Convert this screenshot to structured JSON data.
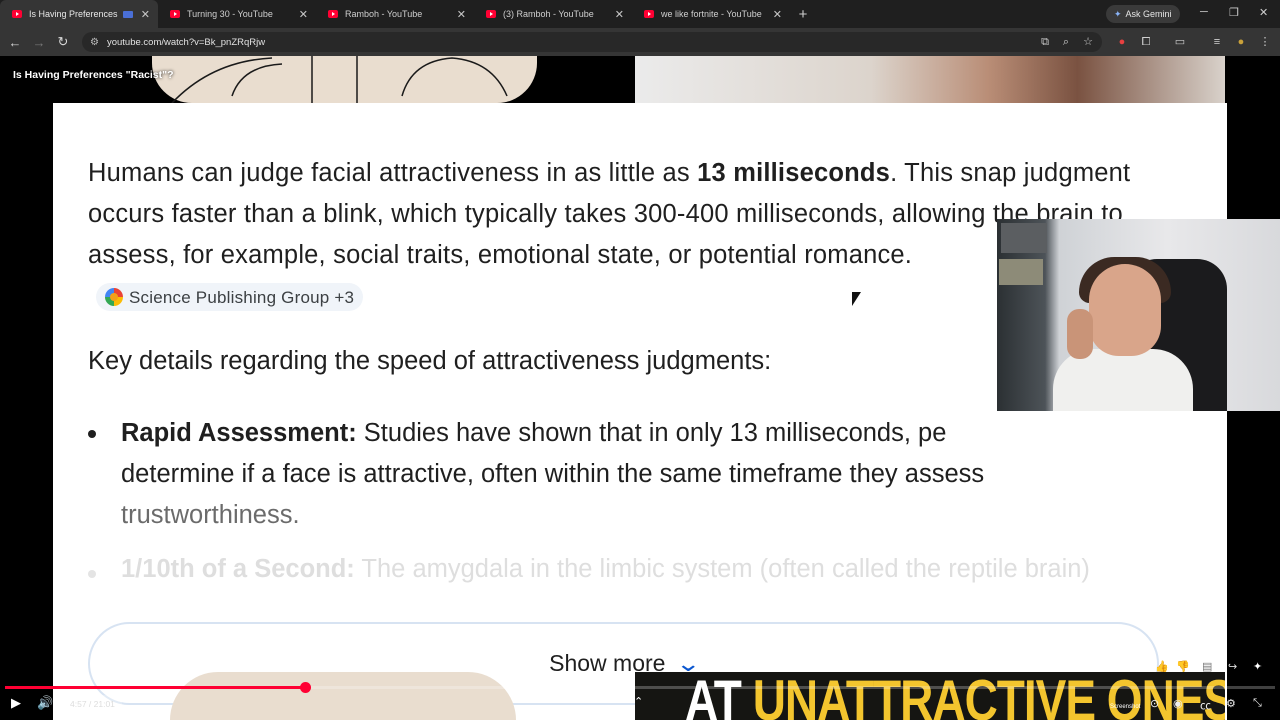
{
  "browser": {
    "tabs": [
      {
        "label": "Is Having Preferences \"Rac",
        "active": true
      },
      {
        "label": "Turning 30 - YouTube",
        "active": false
      },
      {
        "label": "Ramboh - YouTube",
        "active": false
      },
      {
        "label": "(3) Ramboh - YouTube",
        "active": false
      },
      {
        "label": "we like fortnite - YouTube",
        "active": false
      }
    ],
    "new_tab": "+",
    "gemini_label": "Ask Gemini",
    "url": "youtube.com/watch?v=Bk_pnZRqRjw"
  },
  "video": {
    "title": "Is Having Preferences \"Racist\"?",
    "card": {
      "para_a": "Humans can judge facial attractiveness in as little as ",
      "para_bold": "13 milliseconds",
      "para_b": ". This snap judgment occurs faster than a blink, which typically takes 300-400 milliseconds, allowing the brain to assess, for example, social traits, emotional state, or potential romance.",
      "source_chip": "Science Publishing Group +3",
      "subheading": "Key details regarding the speed of attractiveness judgments:",
      "bullet_title": "Rapid Assessment:",
      "bullet_text": " Studies have shown that in only 13 milliseconds, pe",
      "bullet_text2": "determine if a face is attractive, often within the same timeframe they assess ",
      "bullet_tail": "trustworthiness.",
      "faded_title": "1/10th of a Second:",
      "faded_text": " The amygdala in the limbic system (often called the reptile brain)",
      "show_more": "Show more"
    },
    "banner_white": "AT ",
    "banner_yellow": "UNATTRACTIVE ONES"
  },
  "player": {
    "time": "4:57 / 21:01",
    "progress_fraction": 0.236,
    "screenshot_label": "Screenshot"
  },
  "colors": {
    "accent": "#ff0033",
    "chevron": "#0b57d0"
  }
}
